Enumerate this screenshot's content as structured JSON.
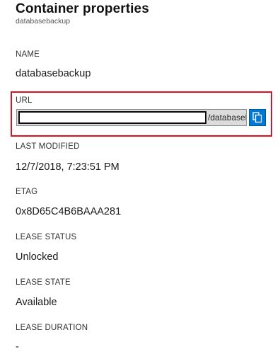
{
  "panel": {
    "title": "Container properties",
    "subtitle": "databasebackup"
  },
  "properties": {
    "name": {
      "label": "NAME",
      "value": "databasebackup"
    },
    "url": {
      "label": "URL",
      "value_visible_tail": "/databasebackup",
      "copy_icon": "copy-icon"
    },
    "last_modified": {
      "label": "LAST MODIFIED",
      "value": "12/7/2018, 7:23:51 PM"
    },
    "etag": {
      "label": "ETAG",
      "value": "0x8D65C4B6BAAA281"
    },
    "lease_status": {
      "label": "LEASE STATUS",
      "value": "Unlocked"
    },
    "lease_state": {
      "label": "LEASE STATE",
      "value": "Available"
    },
    "lease_duration": {
      "label": "LEASE DURATION",
      "value": "-"
    }
  },
  "colors": {
    "highlight_border": "#e0101e",
    "copy_button_bg": "#0078d4"
  }
}
